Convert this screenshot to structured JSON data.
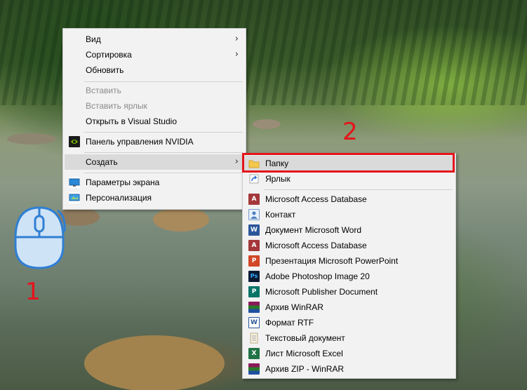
{
  "desktop_menu": {
    "items": [
      {
        "label": "Вид",
        "has_submenu": true,
        "disabled": false
      },
      {
        "label": "Сортировка",
        "has_submenu": true,
        "disabled": false
      },
      {
        "label": "Обновить",
        "has_submenu": false,
        "disabled": false
      },
      {
        "label": "Вставить",
        "has_submenu": false,
        "disabled": true
      },
      {
        "label": "Вставить ярлык",
        "has_submenu": false,
        "disabled": true
      },
      {
        "label": "Открыть в Visual Studio",
        "has_submenu": false,
        "disabled": false
      },
      {
        "label": "Панель управления NVIDIA",
        "has_submenu": false,
        "disabled": false,
        "icon": "nvidia-icon"
      },
      {
        "label": "Создать",
        "has_submenu": true,
        "disabled": false,
        "highlighted": true
      },
      {
        "label": "Параметры экрана",
        "has_submenu": false,
        "disabled": false,
        "icon": "display-settings-icon"
      },
      {
        "label": "Персонализация",
        "has_submenu": false,
        "disabled": false,
        "icon": "personalization-icon"
      }
    ],
    "submenu_arrow": "›"
  },
  "create_submenu": {
    "items": [
      {
        "label": "Папку",
        "icon": "folder-icon",
        "highlighted": true
      },
      {
        "label": "Ярлык",
        "icon": "shortcut-icon"
      },
      {
        "label": "Microsoft Access Database",
        "icon": "access-icon"
      },
      {
        "label": "Контакт",
        "icon": "contact-icon"
      },
      {
        "label": "Документ Microsoft Word",
        "icon": "word-icon"
      },
      {
        "label": "Microsoft Access Database",
        "icon": "access-icon"
      },
      {
        "label": "Презентация Microsoft PowerPoint",
        "icon": "powerpoint-icon"
      },
      {
        "label": "Adobe Photoshop Image 20",
        "icon": "photoshop-icon"
      },
      {
        "label": "Microsoft Publisher Document",
        "icon": "publisher-icon"
      },
      {
        "label": "Архив WinRAR",
        "icon": "winrar-icon"
      },
      {
        "label": "Формат RTF",
        "icon": "rtf-icon"
      },
      {
        "label": "Текстовый документ",
        "icon": "text-document-icon"
      },
      {
        "label": "Лист Microsoft Excel",
        "icon": "excel-icon"
      },
      {
        "label": "Архив ZIP - WinRAR",
        "icon": "winrar-zip-icon"
      }
    ]
  },
  "annotations": {
    "step1": "1",
    "step2": "2",
    "mouse_icon": "mouse-right-click-icon"
  },
  "colors": {
    "menu_bg": "#f2f2f2",
    "menu_hover": "#dadada",
    "annotation_red": "#e5141b",
    "mouse_blue": "#2f7fd3"
  }
}
